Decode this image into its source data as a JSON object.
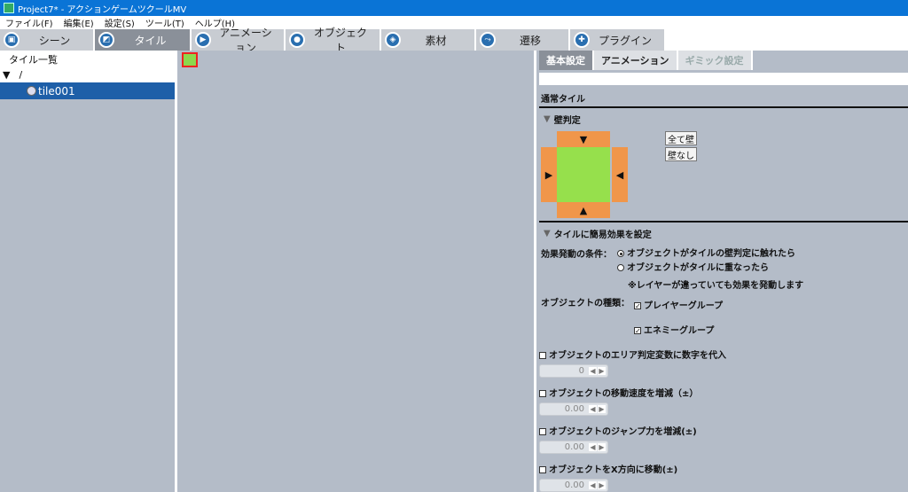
{
  "window": {
    "title": "Project7* - アクションゲームツクールMV"
  },
  "menu": [
    "ファイル(F)",
    "編集(E)",
    "設定(S)",
    "ツール(T)",
    "ヘルプ(H)"
  ],
  "main_tabs": [
    {
      "label": "シーン",
      "icon": "scene-icon"
    },
    {
      "label": "タイル",
      "icon": "tile-icon"
    },
    {
      "label": "アニメーション",
      "icon": "animation-icon"
    },
    {
      "label": "オブジェクト",
      "icon": "object-icon"
    },
    {
      "label": "素材",
      "icon": "material-icon"
    },
    {
      "label": "遷移",
      "icon": "transition-icon"
    },
    {
      "label": "プラグイン",
      "icon": "plugin-icon"
    }
  ],
  "tree": {
    "heading": "タイル一覧",
    "root": "/",
    "item": "tile001"
  },
  "panel_tabs": [
    "基本設定",
    "アニメーション",
    "ギミック設定"
  ],
  "normal_tile": "通常タイル",
  "wall": {
    "section": "壁判定",
    "all_wall": "全て壁",
    "no_wall": "壁なし"
  },
  "effect": {
    "section": "タイルに簡易効果を設定",
    "condition_label": "効果発動の条件：",
    "condition_opt1": "オブジェクトがタイルの壁判定に触れたら",
    "condition_opt2": "オブジェクトがタイルに重なったら",
    "note": "※レイヤーが違っていても効果を発動します",
    "object_type_label": "オブジェクトの種類：",
    "player_group": "プレイヤーグループ",
    "enemy_group": "エネミーグループ",
    "area_var": "オブジェクトのエリア判定変数に数字を代入",
    "area_var_value": "0",
    "speed": "オブジェクトの移動速度を増減（±）",
    "speed_value": "0.00",
    "jump": "オブジェクトのジャンプ力を増減(±)",
    "jump_value": "0.00",
    "move_x": "オブジェクトをX方向に移動(±)",
    "move_x_value": "0.00"
  }
}
